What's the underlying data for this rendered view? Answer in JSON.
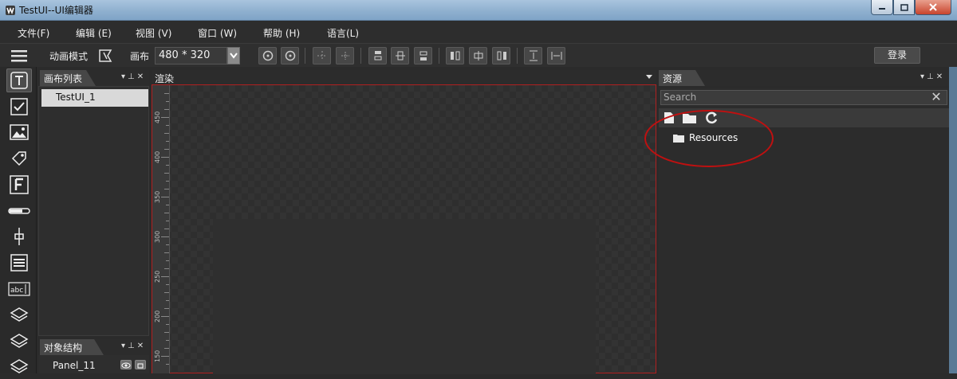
{
  "window": {
    "title": "TestUI--UI编辑器",
    "controls": [
      "minimize-icon",
      "maximize-icon",
      "close-icon"
    ],
    "title_gradient": "#8fb0cf"
  },
  "menu": {
    "items": [
      "文件(F)",
      "编辑 (E)",
      "视图 (V)",
      "窗口 (W)",
      "帮助 (H)",
      "语言(L)"
    ]
  },
  "toolbar": {
    "animation_mode_label": "动画模式",
    "canvas_label": "画布",
    "canvas_size": "480 * 320",
    "login_label": "登录",
    "buttons": [
      "rotate-cw-icon",
      "rotate-ccw-icon",
      "center-horizontal-icon",
      "center-point-icon",
      "align-top-icon",
      "align-middle-icon",
      "align-bottom-icon",
      "align-left-icon",
      "align-center-icon",
      "align-right-icon",
      "distribute-vertical-icon",
      "distribute-horizontal-icon"
    ]
  },
  "tools": [
    "text-tool-icon",
    "checkbox-tool-icon",
    "image-tool-icon",
    "tag-tool-icon",
    "font-tool-icon",
    "slider-tool-icon",
    "vertical-slider-icon",
    "list-tool-icon",
    "textfield-tool-icon",
    "layers-tool-icon",
    "layers-tool-icon",
    "layers-tool-icon"
  ],
  "canvas_list": {
    "title": "画布列表",
    "items": [
      "TestUI_1"
    ]
  },
  "object_structure": {
    "title": "对象结构",
    "items": [
      "Panel_11"
    ]
  },
  "render": {
    "title": "渲染",
    "ruler_labels": [
      "450",
      "400",
      "350",
      "300",
      "250",
      "200",
      "150"
    ],
    "border_color": "#b02020"
  },
  "resources": {
    "title": "资源",
    "search_placeholder": "Search",
    "tree": [
      {
        "label": "Resources",
        "icon": "folder-icon"
      }
    ],
    "annotation_color": "#c01010"
  }
}
